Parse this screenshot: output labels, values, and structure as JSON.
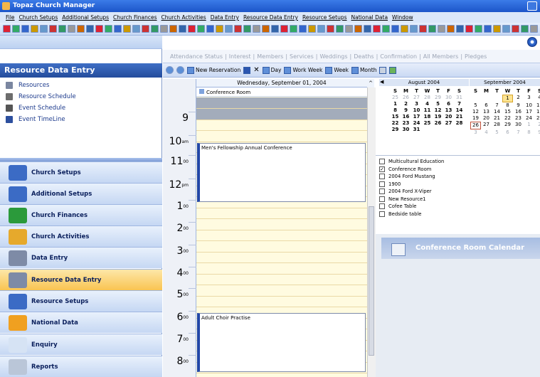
{
  "app": {
    "title": "Topaz Church Manager"
  },
  "menubar": [
    "File",
    "Church Setups",
    "Additional Setups",
    "Church Finances",
    "Church Activities",
    "Data Entry",
    "Resource Data Entry",
    "Resource Setups",
    "National Data",
    "Window"
  ],
  "left_pane": {
    "header": "Resource Data Entry",
    "items": [
      {
        "label": "Resources",
        "icon": "resources-icon"
      },
      {
        "label": "Resource Schedule",
        "icon": "schedule-icon"
      },
      {
        "label": "Event Schedule",
        "icon": "event-icon"
      },
      {
        "label": "Event TimeLine",
        "icon": "timeline-icon"
      }
    ],
    "nav": [
      "Church Setups",
      "Additional Setups",
      "Church Finances",
      "Church Activities",
      "Data Entry",
      "Resource Data Entry",
      "Resource Setups",
      "National Data",
      "Enquiry",
      "Reports"
    ],
    "active_nav": "Resource Data Entry"
  },
  "tabs": [
    "Attendance Status",
    "Interest",
    "Members",
    "Services",
    "Weddings",
    "Deaths",
    "Confirmation",
    "All Members",
    "Pledges"
  ],
  "sched_toolbar": {
    "new_reservation": "New Reservation",
    "day": "Day",
    "work_week": "Work Week",
    "week": "Week",
    "month": "Month"
  },
  "schedule": {
    "date_header": "Wednesday, September 01, 2004",
    "resource": "Conference Room",
    "hours": [
      {
        "h": "9",
        "m": ""
      },
      {
        "h": "10",
        "m": "am"
      },
      {
        "h": "11",
        "m": "00"
      },
      {
        "h": "12",
        "m": "pm"
      },
      {
        "h": "1",
        "m": "00"
      },
      {
        "h": "2",
        "m": "00"
      },
      {
        "h": "3",
        "m": "00"
      },
      {
        "h": "4",
        "m": "00"
      },
      {
        "h": "5",
        "m": "00"
      },
      {
        "h": "6",
        "m": "00"
      },
      {
        "h": "7",
        "m": "00"
      },
      {
        "h": "8",
        "m": "00"
      }
    ],
    "appointments": [
      "Men's Fellowship Annual Conference",
      "Adult Choir Practise"
    ]
  },
  "calendar": {
    "aug_title": "August 2004",
    "sep_title": "September 2004",
    "dow": [
      "S",
      "M",
      "T",
      "W",
      "T",
      "F",
      "S"
    ],
    "aug_rows": [
      [
        "25",
        "26",
        "27",
        "28",
        "29",
        "30",
        "31"
      ],
      [
        "1",
        "2",
        "3",
        "4",
        "5",
        "6",
        "7"
      ],
      [
        "8",
        "9",
        "10",
        "11",
        "12",
        "13",
        "14"
      ],
      [
        "15",
        "16",
        "17",
        "18",
        "19",
        "20",
        "21"
      ],
      [
        "22",
        "23",
        "24",
        "25",
        "26",
        "27",
        "28"
      ],
      [
        "29",
        "30",
        "31",
        "",
        "",
        "",
        ""
      ]
    ],
    "sep_rows": [
      [
        "",
        "",
        "",
        "1",
        "2",
        "3",
        "4"
      ],
      [
        "5",
        "6",
        "7",
        "8",
        "9",
        "10",
        "11"
      ],
      [
        "12",
        "13",
        "14",
        "15",
        "16",
        "17",
        "18"
      ],
      [
        "19",
        "20",
        "21",
        "22",
        "23",
        "24",
        "25"
      ],
      [
        "26",
        "27",
        "28",
        "29",
        "30",
        "1",
        "2"
      ],
      [
        "3",
        "4",
        "5",
        "6",
        "7",
        "8",
        "9"
      ]
    ]
  },
  "resources": [
    {
      "label": "Multicultural Education",
      "checked": false
    },
    {
      "label": "Conference Room",
      "checked": true
    },
    {
      "label": "2004 Ford Mustang",
      "checked": false
    },
    {
      "label": "1900",
      "checked": false
    },
    {
      "label": "2004 Ford X-Viper",
      "checked": false
    },
    {
      "label": "New Resource1",
      "checked": false
    },
    {
      "label": "Cofee Table",
      "checked": false
    },
    {
      "label": "Bedside table",
      "checked": false
    }
  ],
  "calendar_panel_title": "Conference Room Calendar"
}
